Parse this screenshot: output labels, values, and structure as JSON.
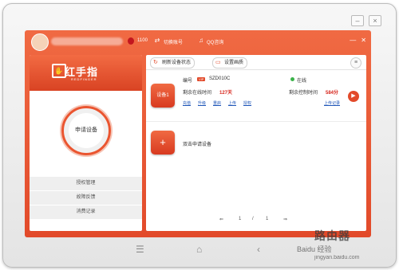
{
  "header": {
    "coins": "1100",
    "switch_account": "切换账号",
    "qq_chat": "QQ咨询"
  },
  "left_panel": {
    "brand_name": "红手指",
    "brand_sub": "REDFINGER",
    "apply_device": "申请设备",
    "menu": [
      "授权管理",
      "故障反馈",
      "消费记录"
    ]
  },
  "toolbar": {
    "refresh": "刷新设备状态",
    "quality": "设置画质"
  },
  "device": {
    "tile_label": "设备1",
    "id_label": "编号",
    "vip_badge": "VIP",
    "id_value": "SZD010C",
    "status": "在线",
    "online_time_label": "剩余在线时间",
    "online_time_value": "127天",
    "control_time_label": "剩余控制时间",
    "control_time_value": "584分",
    "actions": [
      "充值",
      "升级",
      "重启",
      "上传",
      "授权"
    ],
    "upload_log": "上传记录"
  },
  "apply": {
    "plus": "+",
    "label": "双击申请设备"
  },
  "pager": {
    "prev": "⇐",
    "current": "1",
    "sep": "/",
    "total": "1",
    "next": "⇒"
  },
  "watermark": {
    "big": "路由器",
    "small": "Baidu 经验",
    "url": "jingyan.baidu.com"
  },
  "colors": {
    "accent": "#e24a2a",
    "link": "#1f56b8",
    "online": "#3bb34a"
  }
}
